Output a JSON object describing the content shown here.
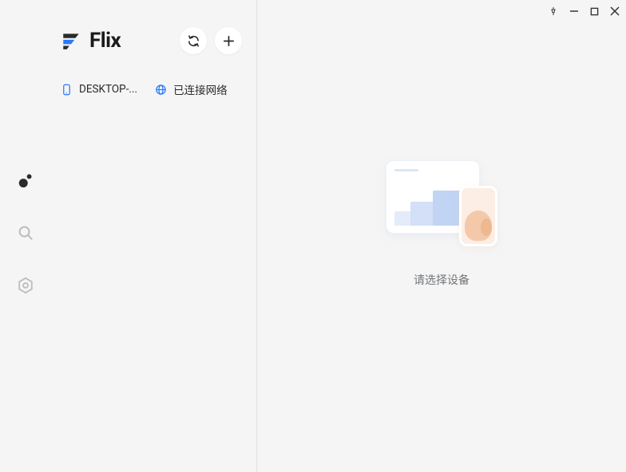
{
  "brand": {
    "name": "Flix"
  },
  "devices": [
    {
      "name": "DESKTOP-..."
    }
  ],
  "network": {
    "status_label": "已连接网络"
  },
  "empty_state": {
    "message": "请选择设备"
  }
}
